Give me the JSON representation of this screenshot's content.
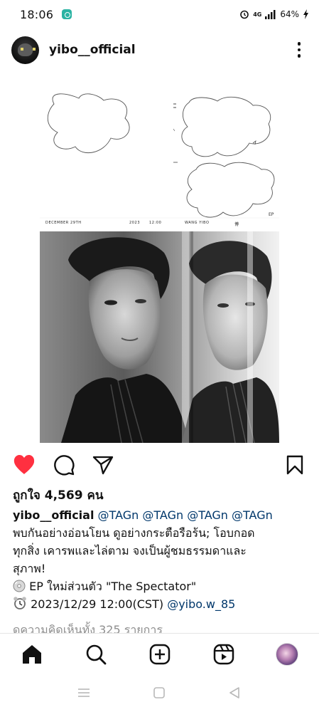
{
  "status_bar": {
    "time": "18:06",
    "battery": "64%",
    "network": "4G"
  },
  "post": {
    "username": "yibo__official",
    "poster": {
      "date_text": "DECEMBER 29TH",
      "year_text": "2023",
      "time_text": "12:00",
      "artist_text": "WANG YIBO",
      "side_mark": "博",
      "ep_text": "EP"
    },
    "likes_text": "ถูกใจ 4,569 คน",
    "caption": {
      "user": "yibo__official",
      "mentions": "@TAGn @TAGn @TAGn @TAGn",
      "line1": "พบกันอย่างอ่อนโยน ดูอย่างกระตือรือร้น; โอบกอด",
      "line2": "ทุกสิ่ง เคารพและไล่ตาม จงเป็นผู้ชมธรรมดาและ",
      "line3": "สุภาพ!",
      "line4": "EP ใหม่ส่วนตัว \"The Spectator\"",
      "line5_text": "2023/12/29 12:00(CST)",
      "line5_mention": "@yibo.w_85"
    },
    "comments_link": "ดูความคิดเห็นทั้ง 325 รายการ"
  },
  "icons": {
    "like": "heart-icon",
    "comment": "comment-icon",
    "share": "send-icon",
    "save": "bookmark-icon",
    "home": "home-icon",
    "search": "search-icon",
    "create": "plus-square-icon",
    "reels": "reels-icon"
  },
  "colors": {
    "like_red": "#ff3040",
    "mention_blue": "#00376b",
    "muted": "#8e8e8e"
  }
}
